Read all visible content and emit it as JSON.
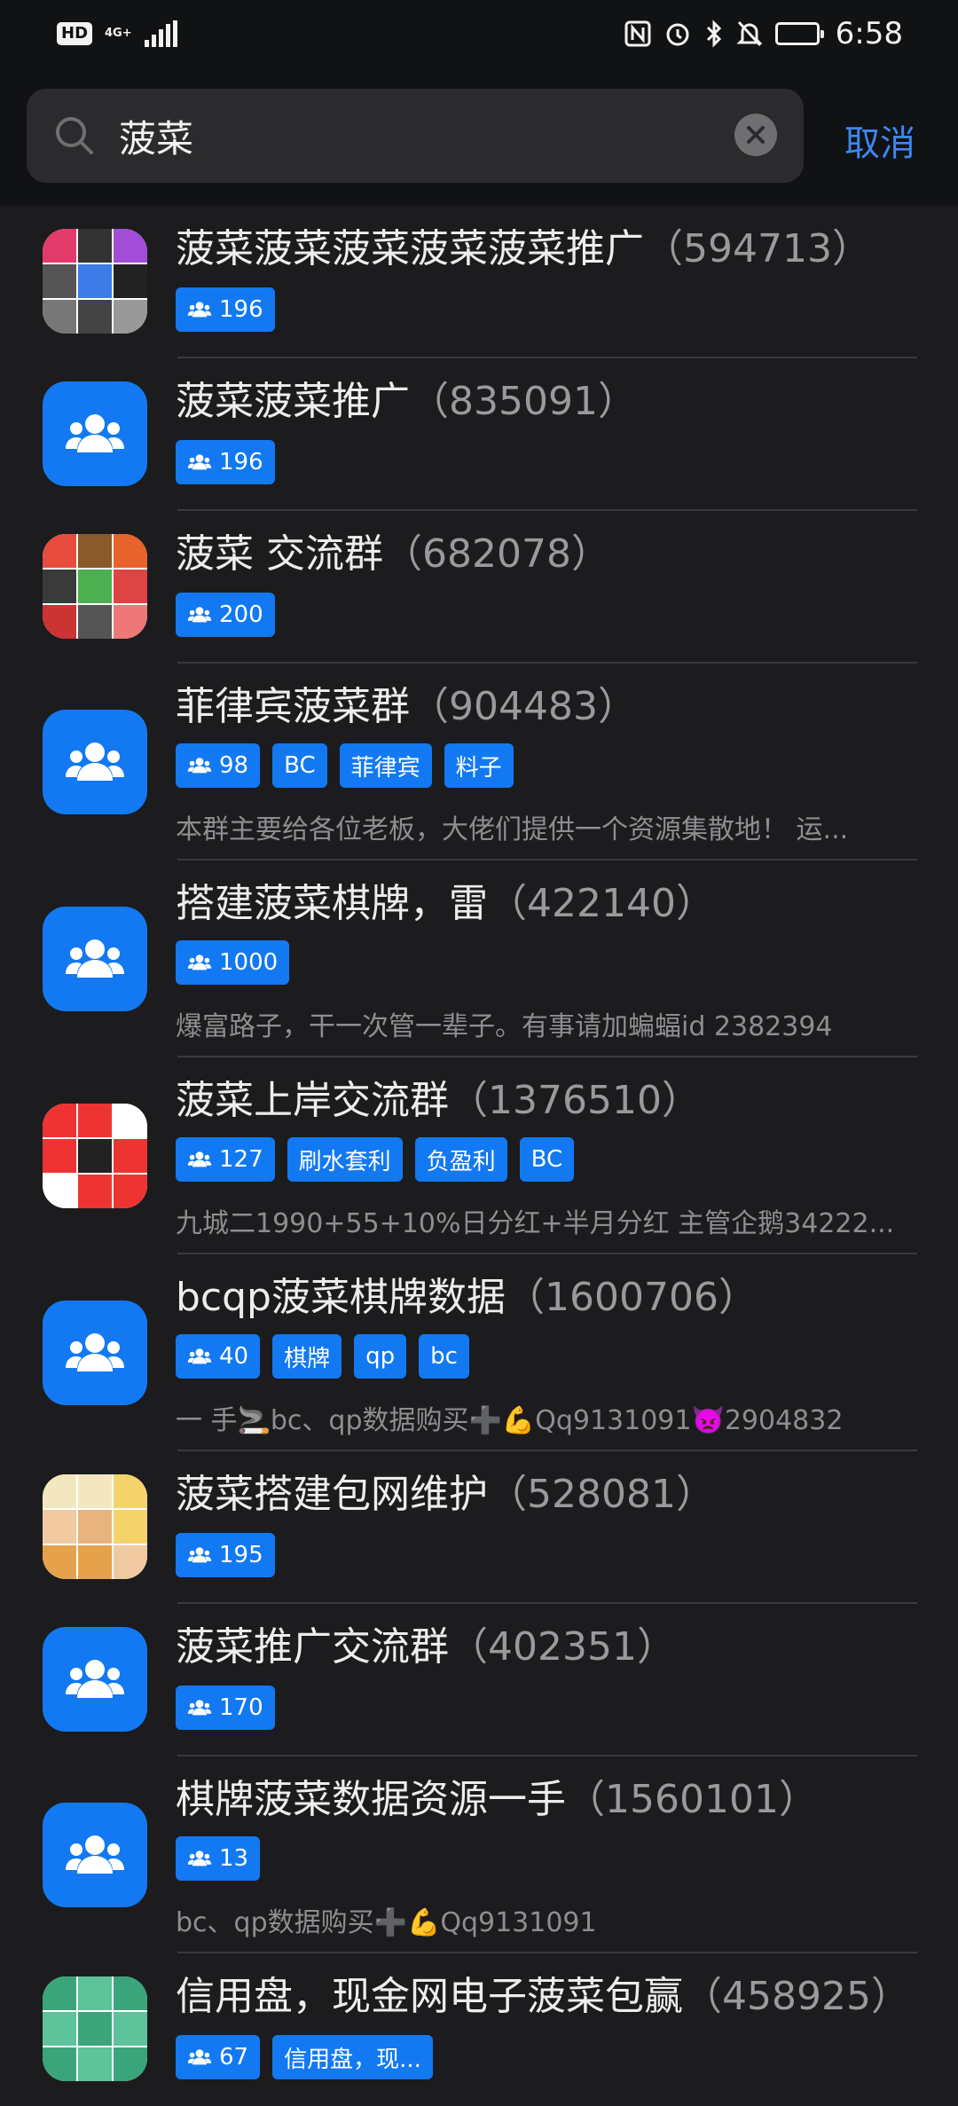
{
  "status_bar": {
    "hd": "HD",
    "network": "4G+",
    "time": "6:58",
    "icons": [
      "nfc-icon",
      "alarm-icon",
      "bluetooth-icon",
      "mute-icon",
      "battery-icon"
    ]
  },
  "search": {
    "query": "菠菜",
    "cancel_label": "取消"
  },
  "colors": {
    "accent": "#1279f3",
    "link": "#3d87f0",
    "background": "#1c1c1e",
    "header": "#111214"
  },
  "results": [
    {
      "name": "菠菜菠菜菠菜菠菜菠菜推广",
      "id": "（594713）",
      "avatar": "image",
      "tags": [
        {
          "icon": true,
          "text": "196"
        }
      ],
      "desc": ""
    },
    {
      "name": "菠菜菠菜推广",
      "id": "（835091）",
      "avatar": "group-icon",
      "tags": [
        {
          "icon": true,
          "text": "196"
        }
      ],
      "desc": ""
    },
    {
      "name": "菠菜  交流群",
      "id": "（682078）",
      "avatar": "image",
      "tags": [
        {
          "icon": true,
          "text": "200"
        }
      ],
      "desc": ""
    },
    {
      "name": "菲律宾菠菜群",
      "id": "（904483）",
      "avatar": "group-icon",
      "tags": [
        {
          "icon": true,
          "text": "98"
        },
        {
          "text": "BC"
        },
        {
          "text": "菲律宾"
        },
        {
          "text": "料子"
        }
      ],
      "desc": "本群主要给各位老板，大佬们提供一个资源集散地！ 运..."
    },
    {
      "name": "搭建菠菜棋牌，雷",
      "id": "（422140）",
      "avatar": "group-icon",
      "tags": [
        {
          "icon": true,
          "text": "1000"
        }
      ],
      "desc": "爆富路子，干一次管一辈子。有事请加蝙蝠id   2382394"
    },
    {
      "name": "菠菜上岸交流群",
      "id": "（1376510）",
      "avatar": "image",
      "tags": [
        {
          "icon": true,
          "text": "127"
        },
        {
          "text": "刷水套利"
        },
        {
          "text": "负盈利"
        },
        {
          "text": "BC"
        }
      ],
      "desc": "九城二1990+55+10%日分红+半月分红  主管企鹅34222..."
    },
    {
      "name": "bcqp菠菜棋牌数据",
      "id": "（1600706）",
      "avatar": "group-icon",
      "tags": [
        {
          "icon": true,
          "text": "40"
        },
        {
          "text": "棋牌"
        },
        {
          "text": "qp"
        },
        {
          "text": "bc"
        }
      ],
      "desc": "一 手🚬bc、qp数据购买➕💪Qq9131091👿2904832"
    },
    {
      "name": "菠菜搭建包网维护",
      "id": "（528081）",
      "avatar": "image",
      "tags": [
        {
          "icon": true,
          "text": "195"
        }
      ],
      "desc": ""
    },
    {
      "name": "菠菜推广交流群",
      "id": "（402351）",
      "avatar": "group-icon",
      "tags": [
        {
          "icon": true,
          "text": "170"
        }
      ],
      "desc": ""
    },
    {
      "name": "棋牌菠菜数据资源一手",
      "id": "（1560101）",
      "avatar": "group-icon",
      "tags": [
        {
          "icon": true,
          "text": "13"
        }
      ],
      "desc": "bc、qp数据购买➕💪Qq9131091"
    },
    {
      "name": "信用盘，现金网电子菠菜包赢",
      "id": "（458925）",
      "avatar": "image",
      "tags": [
        {
          "icon": true,
          "text": "67"
        },
        {
          "text": "信用盘，现..."
        }
      ],
      "desc": ""
    }
  ]
}
